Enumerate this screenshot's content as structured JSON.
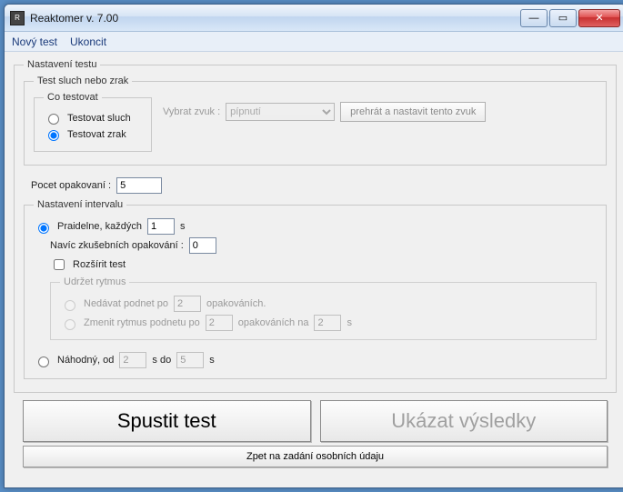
{
  "window": {
    "title": "Reaktomer v. 7.00"
  },
  "menu": {
    "newTest": "Nový test",
    "quit": "Ukoncit"
  },
  "settings": {
    "legend": "Nastavení testu",
    "senseGroup": {
      "legend": "Test sluch nebo zrak",
      "whatGroup": {
        "legend": "Co testovat",
        "hearing": "Testovat sluch",
        "vision": "Testovat zrak"
      },
      "selectSoundLabel": "Vybrat zvuk :",
      "selectedSound": "pípnutí",
      "playBtn": "prehrát a nastavit tento zvuk"
    },
    "reps": {
      "label": "Pocet opakovaní :",
      "value": "5"
    },
    "interval": {
      "legend": "Nastavení intervalu",
      "regular": {
        "label": "Praidelne, každých",
        "value": "1",
        "unit": "s"
      },
      "extra": {
        "label": "Navíc zkušebních opakování :",
        "value": "0"
      },
      "extend": "Rozšírit test",
      "rhythm": {
        "legend": "Udržet rytmus",
        "noStim": {
          "label": "Nedávat podnet po",
          "value": "2",
          "unit": "opakováních."
        },
        "change": {
          "labelA": "Zmenit rytmus podnetu po",
          "valA": "2",
          "mid": "opakováních na",
          "valB": "2",
          "unit": "s"
        }
      },
      "random": {
        "label": "Náhodný, od",
        "from": "2",
        "mid": "s    do",
        "to": "5",
        "unit": "s"
      }
    }
  },
  "buttons": {
    "start": "Spustit test",
    "results": "Ukázat výsledky",
    "back": "Zpet na zadání osobních údaju"
  }
}
